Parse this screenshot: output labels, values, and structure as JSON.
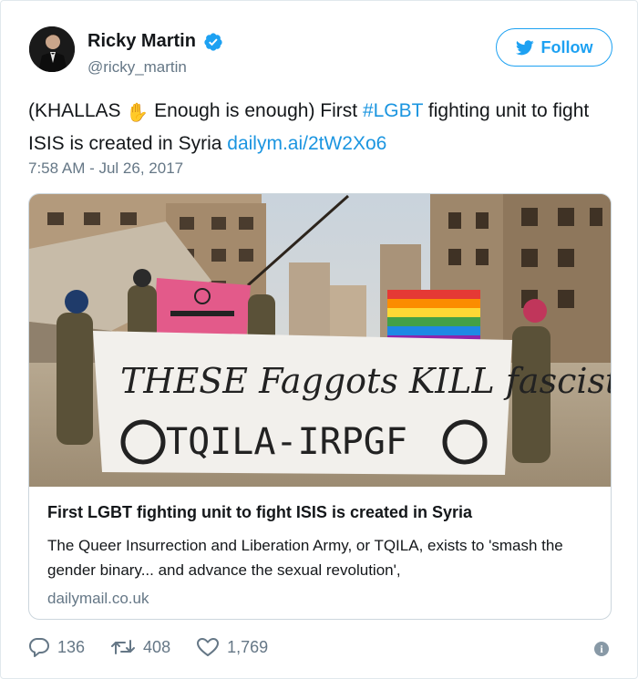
{
  "user": {
    "name": "Ricky Martin",
    "handle": "@ricky_martin",
    "verified": true
  },
  "follow_label": "Follow",
  "tweet": {
    "text_before_emoji": "(KHALLAS ",
    "emoji": "✋",
    "text_after_emoji": " Enough is enough) First ",
    "hashtag": "#LGBT",
    "text_middle": " fighting unit to fight ISIS is created in Syria ",
    "link": "dailym.ai/2tW2Xo6",
    "timestamp": "7:58 AM - Jul 26, 2017"
  },
  "card": {
    "title": "First LGBT fighting unit to fight ISIS is created in Syria",
    "description": "The Queer Insurrection and Liberation Army, or TQILA, exists to 'smash the gender binary... and advance the sexual revolution',",
    "domain": "dailymail.co.uk",
    "banner_line1": "THESE Faggots KILL fascists",
    "banner_line2": "TQILA-IRPGF"
  },
  "actions": {
    "replies": "136",
    "retweets": "408",
    "likes": "1,769"
  },
  "colors": {
    "accent": "#1da1f2",
    "link": "#1b95e0",
    "secondary_text": "#657786"
  },
  "icons": [
    "verified-badge-icon",
    "twitter-bird-icon",
    "reply-icon",
    "retweet-icon",
    "heart-icon",
    "info-icon"
  ]
}
